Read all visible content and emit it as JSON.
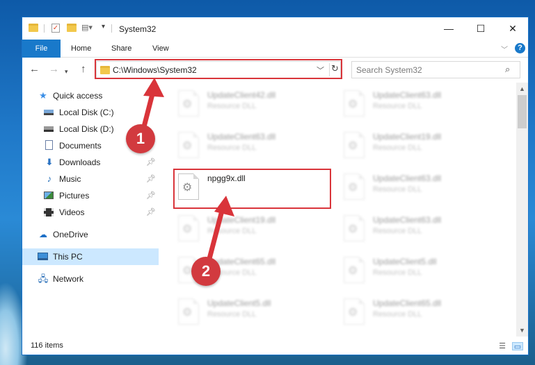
{
  "window": {
    "title": "System32",
    "controls": {
      "minimize": "—",
      "maximize": "☐",
      "close": "✕"
    }
  },
  "ribbon": {
    "tabs": [
      "File",
      "Home",
      "Share",
      "View"
    ],
    "help": "?"
  },
  "address": {
    "path": "C:\\Windows\\System32"
  },
  "search": {
    "placeholder": "Search System32"
  },
  "nav_pane": {
    "items": [
      {
        "label": "Quick access",
        "icon": "star-icon"
      },
      {
        "label": "Local Disk (C:)",
        "icon": "disk-icon"
      },
      {
        "label": "Local Disk (D:)",
        "icon": "disk-icon"
      },
      {
        "label": "Documents",
        "icon": "documents-icon"
      },
      {
        "label": "Downloads",
        "icon": "downloads-icon"
      },
      {
        "label": "Music",
        "icon": "music-icon"
      },
      {
        "label": "Pictures",
        "icon": "pictures-icon"
      },
      {
        "label": "Videos",
        "icon": "videos-icon"
      },
      {
        "label": "OneDrive",
        "icon": "onedrive-icon"
      },
      {
        "label": "This PC",
        "icon": "this-pc-icon"
      },
      {
        "label": "Network",
        "icon": "network-icon"
      }
    ]
  },
  "files": {
    "left": [
      {
        "name": "UpdateClient42.dll",
        "type": "Resource DLL"
      },
      {
        "name": "UpdateClient63.dll",
        "type": "Resource DLL"
      },
      {
        "name": "npgg9x.dll",
        "type": ""
      },
      {
        "name": "UpdateClient19.dll",
        "type": "Resource DLL"
      },
      {
        "name": "UpdateClient65.dll",
        "type": "Resource DLL"
      },
      {
        "name": "UpdateClient5.dll",
        "type": "Resource DLL"
      }
    ],
    "right": [
      {
        "name": "UpdateClient63.dll",
        "type": "Resource DLL"
      },
      {
        "name": "UpdateClient19.dll",
        "type": "Resource DLL"
      },
      {
        "name": "UpdateClient63.dll",
        "type": "Resource DLL"
      },
      {
        "name": "UpdateClient63.dll",
        "type": "Resource DLL"
      },
      {
        "name": "UpdateClient5.dll",
        "type": "Resource DLL"
      },
      {
        "name": "UpdateClient65.dll",
        "type": "Resource DLL"
      }
    ]
  },
  "status": {
    "item_count": "116 items"
  },
  "annotations": {
    "step1": "1",
    "step2": "2",
    "color": "#d9343a"
  }
}
